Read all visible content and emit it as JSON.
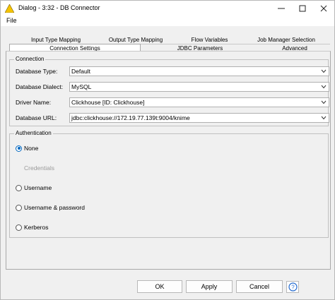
{
  "window": {
    "title": "Dialog - 3:32 - DB Connector"
  },
  "menu": {
    "file": "File"
  },
  "tabs": {
    "row1": [
      "Input Type Mapping",
      "Output Type Mapping",
      "Flow Variables",
      "Job Manager Selection"
    ],
    "row2": [
      "Connection Settings",
      "JDBC Parameters",
      "Advanced"
    ],
    "active": "Connection Settings"
  },
  "connection": {
    "label": "Connection",
    "database_type_label": "Database Type:",
    "database_type_value": "Default",
    "database_dialect_label": "Database Dialect:",
    "database_dialect_value": "MySQL",
    "driver_name_label": "Driver Name:",
    "driver_name_value": "Clickhouse [ID: Clickhouse]",
    "database_url_label": "Database URL:",
    "database_url_value": "jdbc:clickhouse://172.19.77.139t:9004/knime"
  },
  "authentication": {
    "label": "Authentication",
    "options": [
      "None",
      "Credentials",
      "Username",
      "Username & password",
      "Kerberos"
    ],
    "selected": "None",
    "disabled": [
      "Credentials"
    ]
  },
  "buttons": {
    "ok": "OK",
    "apply": "Apply",
    "cancel": "Cancel"
  },
  "icons": {
    "app": "knime-node-icon",
    "help": "help-icon"
  },
  "colors": {
    "accent": "#0067c0",
    "app_icon": "#f5c400"
  }
}
